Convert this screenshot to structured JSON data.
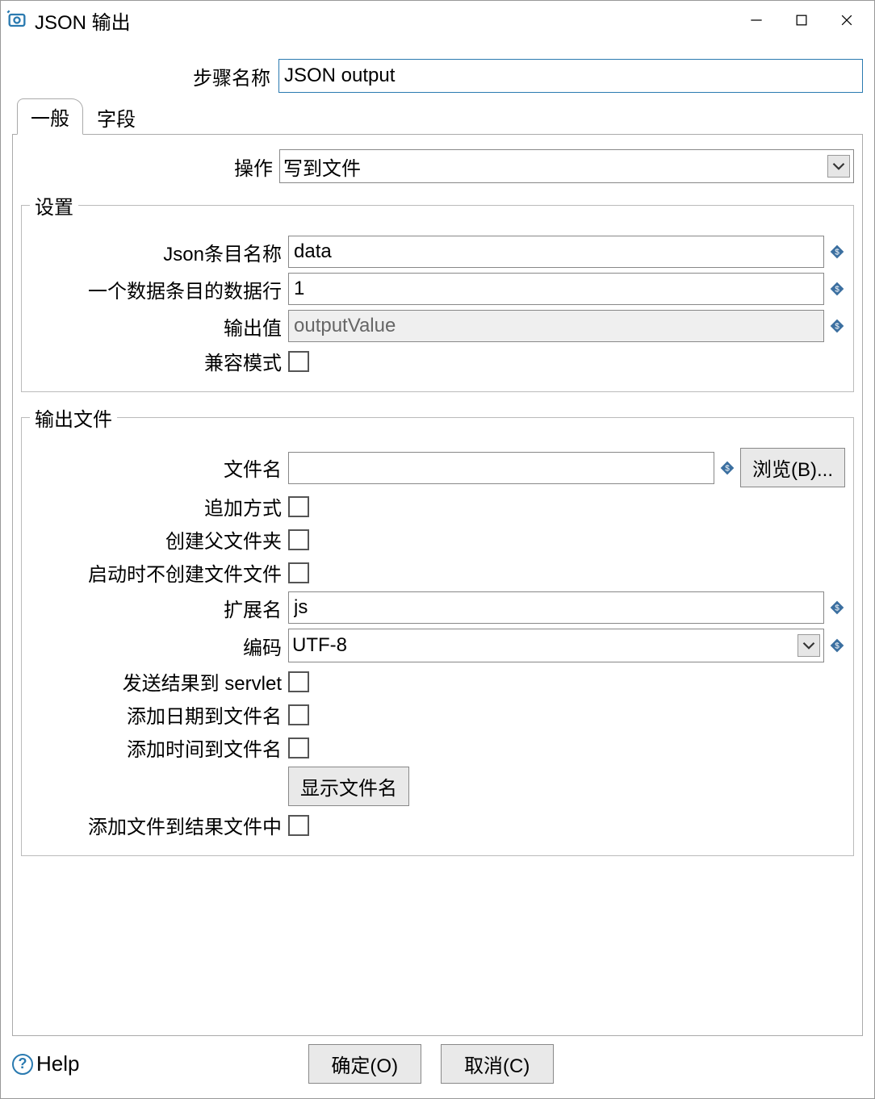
{
  "window": {
    "title": "JSON 输出"
  },
  "step": {
    "label": "步骤名称",
    "value": "JSON output"
  },
  "tabs": {
    "general": "一般",
    "fields": "字段"
  },
  "operation": {
    "label": "操作",
    "value": "写到文件"
  },
  "settings": {
    "legend": "设置",
    "jsonEntryName": {
      "label": "Json条目名称",
      "value": "data"
    },
    "dataRowsPerEntry": {
      "label": "一个数据条目的数据行",
      "value": "1"
    },
    "outputValue": {
      "label": "输出值",
      "value": "outputValue"
    },
    "compatMode": {
      "label": "兼容模式"
    }
  },
  "outputFile": {
    "legend": "输出文件",
    "fileName": {
      "label": "文件名",
      "value": ""
    },
    "browse": "浏览(B)...",
    "appendMode": {
      "label": "追加方式"
    },
    "createParent": {
      "label": "创建父文件夹"
    },
    "dontCreateAtInit": {
      "label": "启动时不创建文件文件"
    },
    "extension": {
      "label": "扩展名",
      "value": "js"
    },
    "encoding": {
      "label": "编码",
      "value": "UTF-8"
    },
    "sendToServlet": {
      "label": "发送结果到 servlet"
    },
    "addDate": {
      "label": "添加日期到文件名"
    },
    "addTime": {
      "label": "添加时间到文件名"
    },
    "showFileName": "显示文件名",
    "addToResult": {
      "label": "添加文件到结果文件中"
    }
  },
  "footer": {
    "help": "Help",
    "ok": "确定(O)",
    "cancel": "取消(C)"
  }
}
